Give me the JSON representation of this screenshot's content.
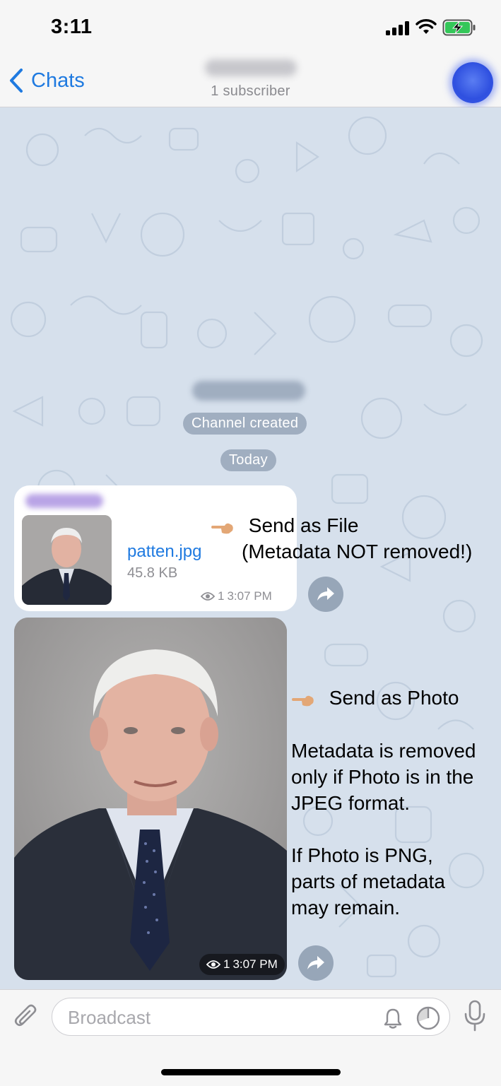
{
  "status_bar": {
    "time": "3:11"
  },
  "nav": {
    "back_label": "Chats",
    "subtitle": "1 subscriber"
  },
  "chat": {
    "service_channel_created": "Channel created",
    "service_today": "Today",
    "file_message": {
      "file_name": "patten.jpg",
      "file_size": "45.8 KB",
      "views": "1",
      "time": "3:07 PM"
    },
    "photo_message": {
      "views": "1",
      "time": "3:07 PM"
    }
  },
  "annotations": {
    "file_line1": "Send as File",
    "file_line2": "(Metadata NOT removed!)",
    "photo_heading": "Send as Photo",
    "photo_para1_line1": "Metadata is removed",
    "photo_para1_line2": "only if Photo is in the",
    "photo_para1_line3": "JPEG format.",
    "photo_para2_line1": "If Photo is PNG,",
    "photo_para2_line2": "parts of metadata",
    "photo_para2_line3": "may remain."
  },
  "input": {
    "placeholder": "Broadcast"
  },
  "colors": {
    "accent": "#1f7ae0",
    "chat_background": "#d6e0ec",
    "service_pill": "#96a5b9"
  },
  "icons": [
    "signal-icon",
    "wifi-icon",
    "battery-charging-icon",
    "chevron-left-icon",
    "eye-icon",
    "share-icon",
    "pointing-hand-icon",
    "paperclip-icon",
    "bell-icon",
    "timer-icon",
    "microphone-icon"
  ]
}
